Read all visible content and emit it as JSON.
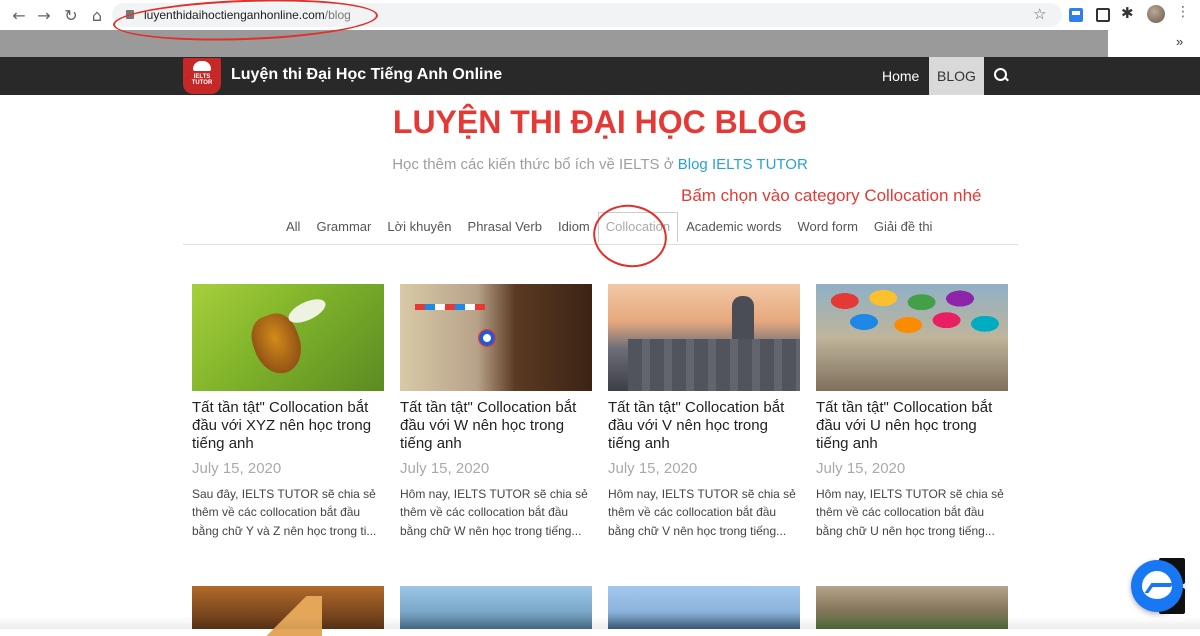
{
  "browser": {
    "url_host": "luyenthidaihoctienganhonline.com",
    "url_path": "/blog",
    "overflow_label": "»"
  },
  "site": {
    "logo_text": "IELTS TUTOR",
    "title": "Luyện thi Đại Học Tiếng Anh Online",
    "nav": {
      "home": "Home",
      "blog": "BLOG"
    }
  },
  "page": {
    "heading": "LUYỆN THI ĐẠI HỌC BLOG",
    "subtitle_prefix": "Học thêm các kiến thức bổ ích về IELTS ở ",
    "subtitle_link": "Blog IELTS TUTOR",
    "annotation": "Bấm chọn vào category Collocation nhé"
  },
  "categories": [
    "All",
    "Grammar",
    "Lời khuyên",
    "Phrasal Verb",
    "Idiom",
    "Collocation",
    "Academic words",
    "Word form",
    "Giải đề thi"
  ],
  "active_category": "Collocation",
  "posts": [
    {
      "title": "Tất tần tật\" Collocation bắt đầu với XYZ nên học trong tiếng anh",
      "date": "July 15, 2020",
      "excerpt": "Sau đây, IELTS TUTOR sẽ chia sẻ thêm về các collocation bắt đầu bằng chữ Y và Z nên học trong ti..."
    },
    {
      "title": "Tất tần tật\" Collocation bắt đầu với W nên học trong tiếng anh",
      "date": "July 15, 2020",
      "excerpt": "Hôm nay, IELTS TUTOR sẽ chia sẻ thêm về các collocation bắt đầu bằng chữ W nên học trong tiếng..."
    },
    {
      "title": "Tất tần tật\" Collocation bắt đầu với V nên học trong tiếng anh",
      "date": "July 15, 2020",
      "excerpt": "Hôm nay, IELTS TUTOR sẽ chia sẻ thêm về các collocation bắt đầu bằng chữ V nên học trong tiếng..."
    },
    {
      "title": "Tất tần tật\" Collocation bắt đầu với U nên học trong tiếng anh",
      "date": "July 15, 2020",
      "excerpt": "Hôm nay, IELTS TUTOR sẽ chia sẻ thêm về các collocation bắt đầu bằng chữ U nên học trong tiếng..."
    }
  ],
  "colors": {
    "accent_red": "#e53935",
    "link_blue": "#29a1d8",
    "nav_bg": "#292929",
    "messenger_blue": "#1877f2"
  }
}
